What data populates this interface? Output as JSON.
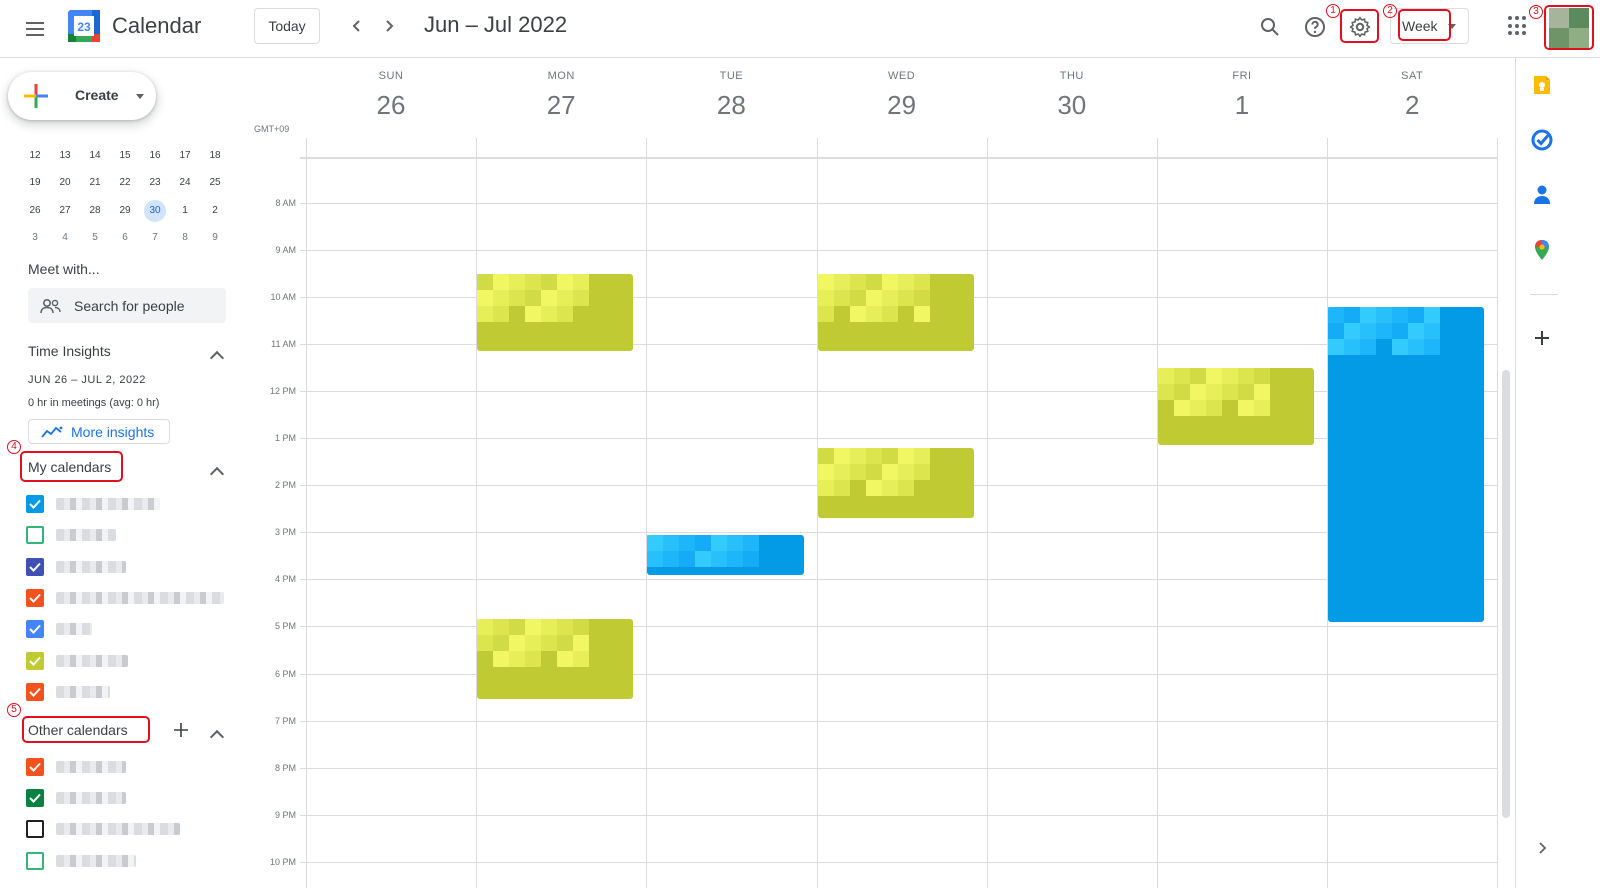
{
  "header": {
    "app_title": "Calendar",
    "logo_date": "23",
    "today_label": "Today",
    "date_range": "Jun – Jul 2022",
    "view_label": "Week"
  },
  "icons": {
    "menu": "hamburger-menu-icon",
    "prev": "chevron-left-icon",
    "next": "chevron-right-icon",
    "search": "search-icon",
    "help": "help-icon",
    "settings": "gear-icon",
    "apps": "apps-grid-icon",
    "keep": "keep-icon",
    "tasks": "tasks-icon",
    "contacts": "contacts-icon",
    "maps": "maps-icon",
    "add": "plus-icon",
    "expand": "chevron-right-icon"
  },
  "annotations": [
    "1",
    "2",
    "3",
    "4",
    "5"
  ],
  "sidebar": {
    "create_label": "Create",
    "mini_calendar": [
      [
        {
          "d": "12"
        },
        {
          "d": "13"
        },
        {
          "d": "14"
        },
        {
          "d": "15"
        },
        {
          "d": "16"
        },
        {
          "d": "17"
        },
        {
          "d": "18"
        }
      ],
      [
        {
          "d": "19"
        },
        {
          "d": "20"
        },
        {
          "d": "21"
        },
        {
          "d": "22"
        },
        {
          "d": "23"
        },
        {
          "d": "24"
        },
        {
          "d": "25"
        }
      ],
      [
        {
          "d": "26"
        },
        {
          "d": "27"
        },
        {
          "d": "28"
        },
        {
          "d": "29"
        },
        {
          "d": "30",
          "today": true
        },
        {
          "d": "1"
        },
        {
          "d": "2"
        }
      ],
      [
        {
          "d": "3",
          "dim": true
        },
        {
          "d": "4",
          "dim": true
        },
        {
          "d": "5",
          "dim": true
        },
        {
          "d": "6",
          "dim": true
        },
        {
          "d": "7",
          "dim": true
        },
        {
          "d": "8",
          "dim": true
        },
        {
          "d": "9",
          "dim": true
        }
      ]
    ],
    "meet_with_title": "Meet with...",
    "search_people_placeholder": "Search for people",
    "time_insights_title": "Time Insights",
    "insights_range": "JUN 26 – JUL 2, 2022",
    "insights_summary": "0 hr in meetings (avg: 0 hr)",
    "more_insights_label": "More insights",
    "my_calendars_title": "My calendars",
    "my_calendars": [
      {
        "checked": true,
        "color": "#039be5"
      },
      {
        "checked": false,
        "color": "#33b679"
      },
      {
        "checked": true,
        "color": "#3f51b5"
      },
      {
        "checked": true,
        "color": "#f4511e"
      },
      {
        "checked": true,
        "color": "#4285f4"
      },
      {
        "checked": true,
        "color": "#c0ca33"
      },
      {
        "checked": true,
        "color": "#f4511e"
      }
    ],
    "other_calendars_title": "Other calendars",
    "other_calendars": [
      {
        "checked": true,
        "color": "#f4511e"
      },
      {
        "checked": true,
        "color": "#0b8043"
      },
      {
        "checked": false,
        "color": "#202124"
      },
      {
        "checked": false,
        "color": "#33b679"
      }
    ]
  },
  "week": {
    "timezone": "GMT+09",
    "days": [
      {
        "dow": "SUN",
        "num": "26"
      },
      {
        "dow": "MON",
        "num": "27"
      },
      {
        "dow": "TUE",
        "num": "28"
      },
      {
        "dow": "WED",
        "num": "29"
      },
      {
        "dow": "THU",
        "num": "30"
      },
      {
        "dow": "FRI",
        "num": "1"
      },
      {
        "dow": "SAT",
        "num": "2"
      }
    ],
    "hours": [
      "8 AM",
      "9 AM",
      "10 AM",
      "11 AM",
      "12 PM",
      "1 PM",
      "2 PM",
      "3 PM",
      "4 PM",
      "5 PM",
      "6 PM",
      "7 PM",
      "8 PM",
      "9 PM",
      "10 PM"
    ],
    "events": [
      {
        "day": 1,
        "start": 9.5,
        "end": 11.15,
        "color": "#c0ca33"
      },
      {
        "day": 3,
        "start": 9.5,
        "end": 11.15,
        "color": "#c0ca33"
      },
      {
        "day": 5,
        "start": 11.5,
        "end": 13.15,
        "color": "#c0ca33"
      },
      {
        "day": 6,
        "start": 10.2,
        "end": 16.9,
        "color": "#039be5"
      },
      {
        "day": 3,
        "start": 13.2,
        "end": 14.7,
        "color": "#c0ca33"
      },
      {
        "day": 2,
        "start": 15.05,
        "end": 15.9,
        "color": "#039be5"
      },
      {
        "day": 1,
        "start": 16.85,
        "end": 18.55,
        "color": "#c0ca33"
      }
    ]
  }
}
